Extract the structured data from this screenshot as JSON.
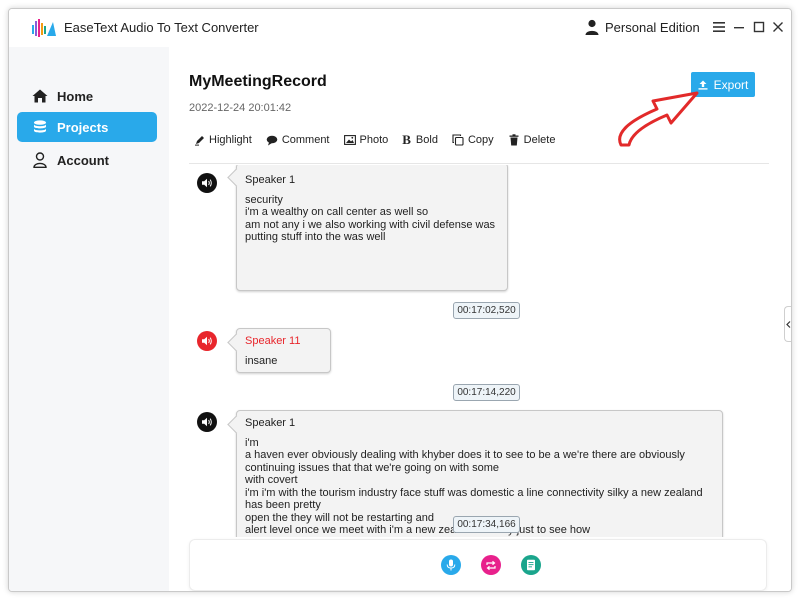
{
  "app": {
    "title": "EaseText Audio To Text Converter",
    "edition": "Personal Edition",
    "accent_color": "#29a9ea"
  },
  "sidebar": {
    "items": [
      {
        "label": "Home",
        "icon": "home-icon",
        "active": false
      },
      {
        "label": "Projects",
        "icon": "database-icon",
        "active": true
      },
      {
        "label": "Account",
        "icon": "user-icon",
        "active": false
      }
    ]
  },
  "record": {
    "title": "MyMeetingRecord",
    "date": "2022-12-24 20:01:42"
  },
  "export": {
    "label": "Export",
    "icon": "upload-icon"
  },
  "toolbar": {
    "highlight": "Highlight",
    "comment": "Comment",
    "photo": "Photo",
    "bold": "Bold",
    "copy": "Copy",
    "delete": "Delete"
  },
  "transcript": {
    "segments": [
      {
        "speaker": "Speaker 1",
        "speaker_color": "#222222",
        "icon": "speaker-icon",
        "lines": [
          "security",
          "i'm a wealthy on call center as well so",
          "am not any i we also working with civil defense was",
          "putting stuff into the was well"
        ],
        "timestamp": "00:17:02,520"
      },
      {
        "speaker": "Speaker 11",
        "speaker_color": "#e8262c",
        "icon": "speaker-icon",
        "lines": [
          "insane"
        ],
        "timestamp": "00:17:14,220"
      },
      {
        "speaker": "Speaker 1",
        "speaker_color": "#222222",
        "icon": "speaker-icon",
        "lines": [
          "i'm",
          "a haven ever obviously dealing with khyber does it to see to be a we're there are obviously",
          "continuing issues that that we're going on with some",
          "with covert",
          "i'm i'm with the tourism industry face stuff was domestic a line connectivity silky a new zealand",
          "has been pretty",
          "open the they will not be restarting and",
          "alert level once we meet with i'm a new zealand weekly just to see how"
        ],
        "timestamp": "00:17:34,166"
      }
    ]
  },
  "bottom_controls": [
    {
      "icon": "microphone-icon",
      "color": "#29a9ea"
    },
    {
      "icon": "repeat-icon",
      "color": "#e8218c"
    },
    {
      "icon": "document-icon",
      "color": "#1aa58c"
    }
  ]
}
